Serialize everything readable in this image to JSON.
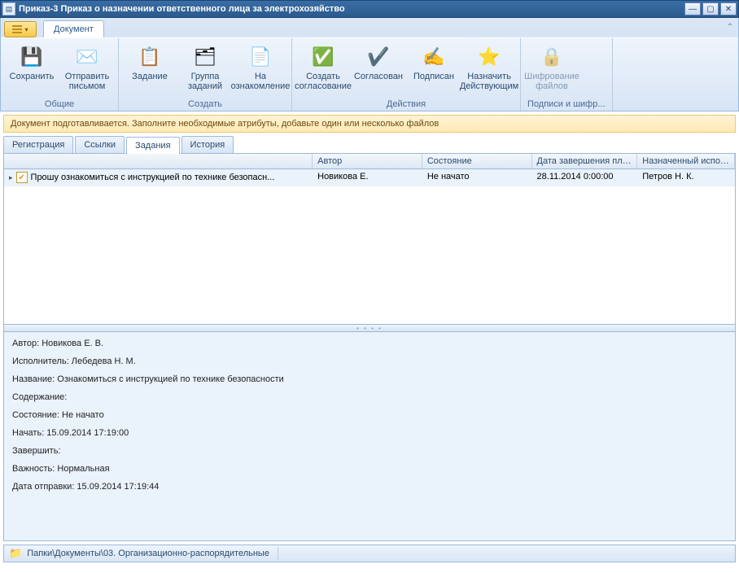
{
  "window": {
    "title": "Приказ-3 Приказ о назначении ответственного лица за электрохозяйство"
  },
  "ribbon_tab": "Документ",
  "ribbon": {
    "groups": [
      {
        "label": "Общие",
        "buttons": [
          {
            "name": "save",
            "label": "Сохранить",
            "icon": "💾"
          },
          {
            "name": "send-mail",
            "label": "Отправить письмом",
            "icon": "✉️"
          }
        ]
      },
      {
        "label": "Создать",
        "buttons": [
          {
            "name": "task",
            "label": "Задание",
            "icon": "📋"
          },
          {
            "name": "task-group",
            "label": "Группа заданий",
            "icon": "🗂"
          },
          {
            "name": "acquaint",
            "label": "На ознакомление",
            "icon": "📄"
          }
        ]
      },
      {
        "label": "Действия",
        "buttons": [
          {
            "name": "create-approval",
            "label": "Создать согласование",
            "icon": "✅"
          },
          {
            "name": "approved",
            "label": "Согласован",
            "icon": "✔️"
          },
          {
            "name": "signed",
            "label": "Подписан",
            "icon": "✍️"
          },
          {
            "name": "set-active",
            "label": "Назначить Действующим",
            "icon": "⭐"
          }
        ]
      },
      {
        "label": "Подписи и шифр...",
        "buttons": [
          {
            "name": "encrypt",
            "label": "Шифрование файлов",
            "icon": "🔒",
            "disabled": true
          }
        ]
      }
    ]
  },
  "infobar": "Документ подготавливается. Заполните необходимые атрибуты, добавьте один или несколько файлов",
  "subtabs": [
    "Регистрация",
    "Ссылки",
    "Задания",
    "История"
  ],
  "active_subtab": 2,
  "grid": {
    "columns": [
      "",
      "Автор",
      "Состояние",
      "Дата завершения план...",
      "Назначенный исполни..."
    ],
    "row": {
      "text": "Прошу ознакомиться с инструкцией по технике безопасн...",
      "author": "Новикова Е.",
      "state": "Не начато",
      "plan_end": "28.11.2014 0:00:00",
      "assignee": "Петров Н. К."
    }
  },
  "detail": {
    "lines": [
      "Автор: Новикова Е. В.",
      "Исполнитель: Лебедева Н. М.",
      "Название: Ознакомиться с инструкцией по технике безопасности",
      "Содержание:",
      "Состояние: Не начато",
      "Начать: 15.09.2014 17:19:00",
      "Завершить:",
      "Важность: Нормальная",
      "Дата отправки: 15.09.2014 17:19:44"
    ]
  },
  "statusbar": {
    "path": "Папки\\Документы\\03. Организационно-распорядительные"
  }
}
